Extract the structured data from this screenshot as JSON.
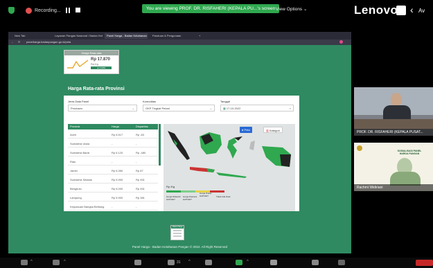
{
  "meeting": {
    "recording_label": "Recording...",
    "viewing_banner": "You are viewing PROF. DR. RISFAHERI (KEPALA PU...'s screen",
    "view_options_label": "View Options ⌄",
    "brand": "Lenovo",
    "right_label": "Av"
  },
  "browser": {
    "tabs": [
      "New Tab",
      "Layanan Pangan Nasional / Badan Kebi",
      "Panel Harga - Badan Ketahanan",
      "Panduan & Pengunaan",
      "+"
    ],
    "url": "panelharga.badanpangan.go.id/peta"
  },
  "price_card": {
    "header": "Harga Rata-rata",
    "value": "Rp 17.870",
    "unit": "Per Kg",
    "change": "▲ 0.00%"
  },
  "panel": {
    "title": "Harga Rata-rata Provinsi",
    "level_label": "Jenis Data Panel",
    "level_value": "Produsen",
    "commodity_label": "Komoditas",
    "commodity_value": "GKP Tingkat Petani",
    "date_label": "Tanggal",
    "date_value": "17-10-2022",
    "table_headers": [
      "Provinsi",
      "Harga",
      "Disparitas"
    ],
    "rows": [
      {
        "prov": "Aceh",
        "price": "Rp 6.517",
        "disp": "Rp -83"
      },
      {
        "prov": "Sumatera Utara",
        "price": "-",
        "disp": "-"
      },
      {
        "prov": "Sumatera Barat",
        "price": "Rp 6.120",
        "disp": "Rp -480"
      },
      {
        "prov": "Riau",
        "price": "-",
        "disp": "-"
      },
      {
        "prov": "Jambi",
        "price": "Rp 6.350",
        "disp": "Rp 87"
      },
      {
        "prov": "Sumatera Selatan",
        "price": "Rp 5.900",
        "disp": "Rp 451"
      },
      {
        "prov": "Bengkulu",
        "price": "Rp 6.000",
        "disp": "Rp 451"
      },
      {
        "prov": "Lampung",
        "price": "Rp 5.900",
        "disp": "Rp 381"
      },
      {
        "prov": "Kepulauan Bangka Belitung",
        "price": "-",
        "disp": "-"
      }
    ],
    "map_btn_map": "Peta",
    "map_btn_cat": "Kategori",
    "legend_title": "Rp /Kg",
    "legend_items": [
      "Harga Dibawah HAP/HET",
      "Harga Diantara HAP/HET",
      "Harga Diatas HAP/HET",
      "Tidak Ada Data"
    ],
    "legend_colors": [
      "#2fa84f",
      "#7fcf8a",
      "#e8d34a",
      "#cc3333",
      "#bbbbbb"
    ]
  },
  "badge": {
    "title": "Status Harga"
  },
  "footer": "Panel Harga - Badan Ketahanan Pangan © 2022. All Right Reserved",
  "participants": [
    {
      "name": "PROF. DR. RISFAHERI (KEPALA PUSAT..."
    },
    {
      "name": "Rachmi Widiriani"
    }
  ],
  "slide": {
    "title": "SOSIALISASI PANEL HARGA PANGAN"
  },
  "taskbar": {
    "count": "31"
  }
}
